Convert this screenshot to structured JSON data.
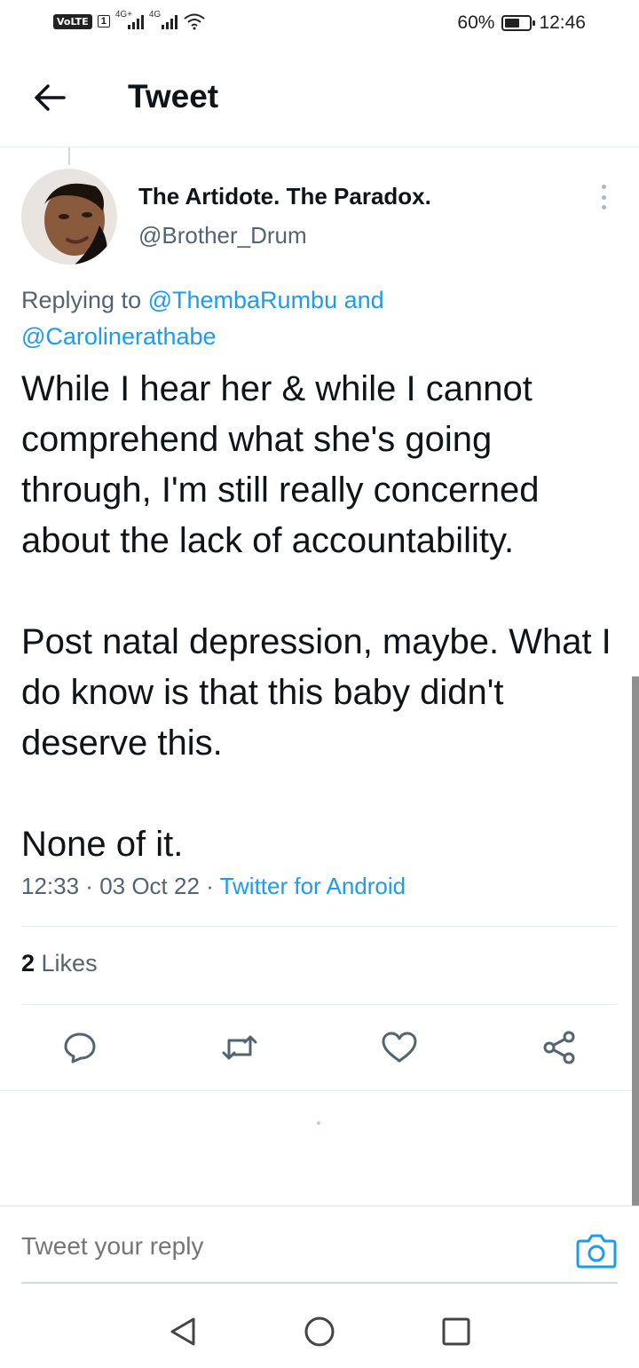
{
  "status_bar": {
    "volte": "VoLTE",
    "sim": "1",
    "signal1_tag": "4G+",
    "signal2_tag": "4G",
    "battery": "60%",
    "battery_level": 0.6,
    "time": "12:46"
  },
  "header": {
    "title": "Tweet",
    "back_icon": "arrow-left-icon"
  },
  "tweet": {
    "author_name": "The Artidote. The Paradox.",
    "author_handle": "@Brother_Drum",
    "replying_prefix": "Replying to ",
    "reply_mention_1": "@ThembaRumbu",
    "reply_and": " and",
    "reply_mention_2": "@Carolinerathabe",
    "body": "While I hear her & while I cannot comprehend what she's going through, I'm still really concerned about the lack of accountability.\n\nPost natal depression, maybe. What I do know is that this baby didn't deserve this.\n\nNone of it.",
    "time": "12:33",
    "sep1": " · ",
    "date": "03 Oct 22",
    "sep2": " · ",
    "source": "Twitter for Android",
    "likes_count": "2",
    "likes_label": " Likes"
  },
  "actions": [
    {
      "name": "reply",
      "icon": "comment-icon"
    },
    {
      "name": "retweet",
      "icon": "retweet-icon"
    },
    {
      "name": "like",
      "icon": "heart-icon"
    },
    {
      "name": "share",
      "icon": "share-icon"
    }
  ],
  "reply_bar": {
    "placeholder": "Tweet your reply",
    "camera_icon": "camera-icon"
  },
  "nav": {
    "back_icon": "triangle-back-icon",
    "home_icon": "circle-home-icon",
    "recents_icon": "square-recents-icon"
  },
  "colors": {
    "accent": "#1d9bf0",
    "text": "#0f1419",
    "secondary": "#536471",
    "divider": "#e6ecf0"
  }
}
